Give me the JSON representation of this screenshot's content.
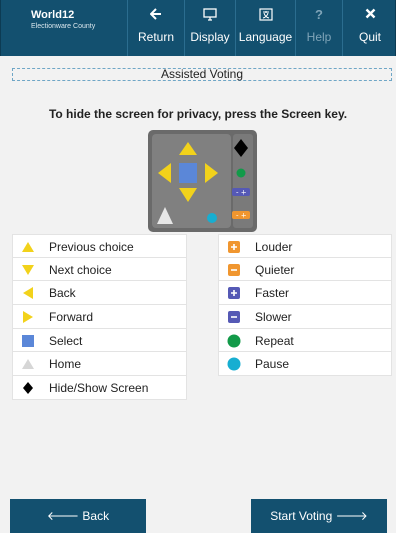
{
  "header": {
    "brand_title": "World12",
    "brand_subtitle": "Electionware County",
    "buttons": [
      {
        "label": "Return",
        "icon": "arrow-left-icon",
        "glyph": "🡐",
        "enabled": true
      },
      {
        "label": "Display",
        "icon": "monitor-icon",
        "glyph": "🖵",
        "enabled": true
      },
      {
        "label": "Language",
        "icon": "language-icon",
        "glyph": "文A",
        "enabled": true
      },
      {
        "label": "Help",
        "icon": "help-icon",
        "glyph": "?",
        "enabled": false
      },
      {
        "label": "Quit",
        "icon": "close-icon",
        "glyph": "✖",
        "enabled": true
      }
    ]
  },
  "title": "Assisted Voting",
  "instruction": "To hide the screen for privacy, press the Screen key.",
  "legend_left": [
    {
      "label": "Previous choice",
      "icon": "triangle-up-icon"
    },
    {
      "label": "Next choice",
      "icon": "triangle-down-icon"
    },
    {
      "label": "Back",
      "icon": "triangle-left-icon"
    },
    {
      "label": "Forward",
      "icon": "triangle-right-icon"
    },
    {
      "label": "Select",
      "icon": "square-select-icon"
    },
    {
      "label": "Home",
      "icon": "triangle-home-icon"
    },
    {
      "label": "Hide/Show Screen",
      "icon": "diamond-icon"
    }
  ],
  "legend_right": [
    {
      "label": "Louder",
      "icon": "plus-orange-icon"
    },
    {
      "label": "Quieter",
      "icon": "minus-orange-icon"
    },
    {
      "label": "Faster",
      "icon": "plus-purple-icon"
    },
    {
      "label": "Slower",
      "icon": "minus-purple-icon"
    },
    {
      "label": "Repeat",
      "icon": "circle-green-icon"
    },
    {
      "label": "Pause",
      "icon": "circle-teal-icon"
    }
  ],
  "footer": {
    "back_label": "Back",
    "start_label": "Start Voting"
  },
  "colors": {
    "primary": "#13506f",
    "yellow": "#f2d21b",
    "select_blue": "#5b87d8",
    "orange": "#f0962f",
    "purple": "#5559b5",
    "green": "#129a49",
    "teal": "#17aed1"
  }
}
